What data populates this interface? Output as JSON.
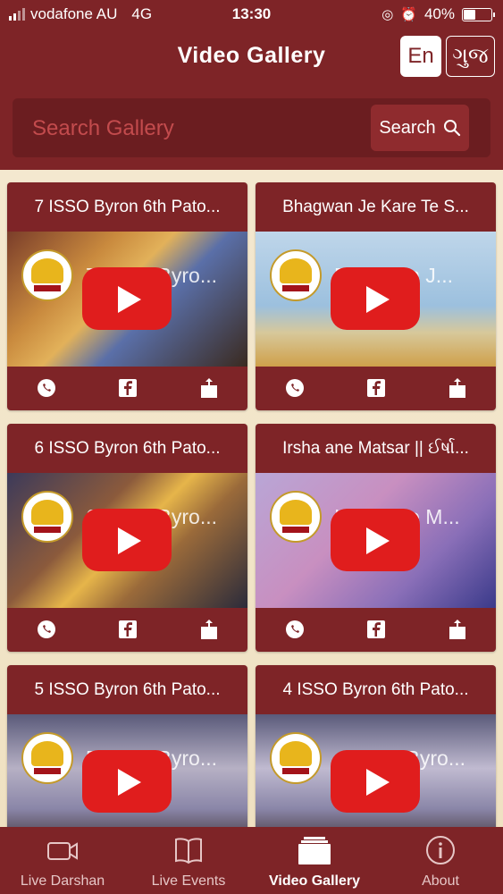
{
  "status_bar": {
    "carrier": "vodafone AU",
    "network": "4G",
    "time": "13:30",
    "battery": "40%"
  },
  "header": {
    "title": "Video Gallery",
    "lang_en": "En",
    "lang_guj": "ગુજ"
  },
  "search": {
    "placeholder": "Search Gallery",
    "button_label": "Search"
  },
  "videos": [
    {
      "title": "7 ISSO Byron 6th Pato...",
      "overlay": "7 ISSO Byro..."
    },
    {
      "title": "Bhagwan Je Kare Te S...",
      "overlay": "Bhagwan J..."
    },
    {
      "title": "6 ISSO Byron 6th Pato...",
      "overlay": "6 ISSO Byro..."
    },
    {
      "title": "Irsha ane Matsar || ઈર્ષા...",
      "overlay": "Irsha ane M..."
    },
    {
      "title": "5 ISSO Byron 6th Pato...",
      "overlay": "5 ISSO Byro..."
    },
    {
      "title": "4 ISSO Byron 6th Pato...",
      "overlay": "4 ISSO Byro..."
    }
  ],
  "tabs": [
    {
      "label": "Live Darshan",
      "icon": "video-camera-icon"
    },
    {
      "label": "Live Events",
      "icon": "book-icon"
    },
    {
      "label": "Video Gallery",
      "icon": "gallery-stack-icon",
      "active": true
    },
    {
      "label": "About",
      "icon": "info-icon"
    }
  ],
  "colors": {
    "brand": "#7e2427",
    "play": "#e01d1d",
    "background": "#f4e8cf"
  }
}
